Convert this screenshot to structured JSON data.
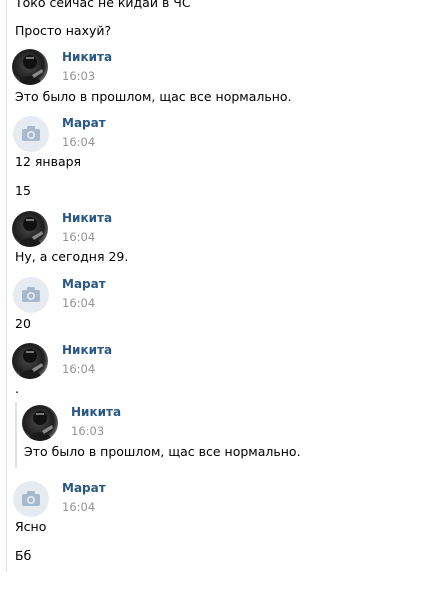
{
  "messages": {
    "m0_line1": "Токо сейчас не кидай в ЧС",
    "m0_line2": "Просто нахуй?",
    "b1_name": "Никита",
    "b1_time": "16:03",
    "b1_text": "Это было в прошлом, щас все нормально.",
    "b2_name": "Марат",
    "b2_time": "16:04",
    "b2_text1": "12 января",
    "b2_text2": "15",
    "b3_name": "Никита",
    "b3_time": "16:04",
    "b3_text": "Ну, а сегодня 29.",
    "b4_name": "Марат",
    "b4_time": "16:04",
    "b4_text": "20",
    "b5_name": "Никита",
    "b5_time": "16:04",
    "b5_text": ".",
    "q_name": "Никита",
    "q_time": "16:03",
    "q_text": "Это было в прошлом, щас все нормально.",
    "b6_name": "Марат",
    "b6_time": "16:04",
    "b6_text1": "Ясно",
    "b6_text2": "Бб"
  },
  "icons": {
    "nikita_avatar": "user-photo-icon",
    "marat_avatar": "camera-placeholder-icon"
  },
  "colors": {
    "name": "#2a5885",
    "time": "#939393",
    "divider": "#e1e3e6",
    "placeholder_bg": "#e5ebf1",
    "placeholder_icon": "#a8b9cc"
  }
}
